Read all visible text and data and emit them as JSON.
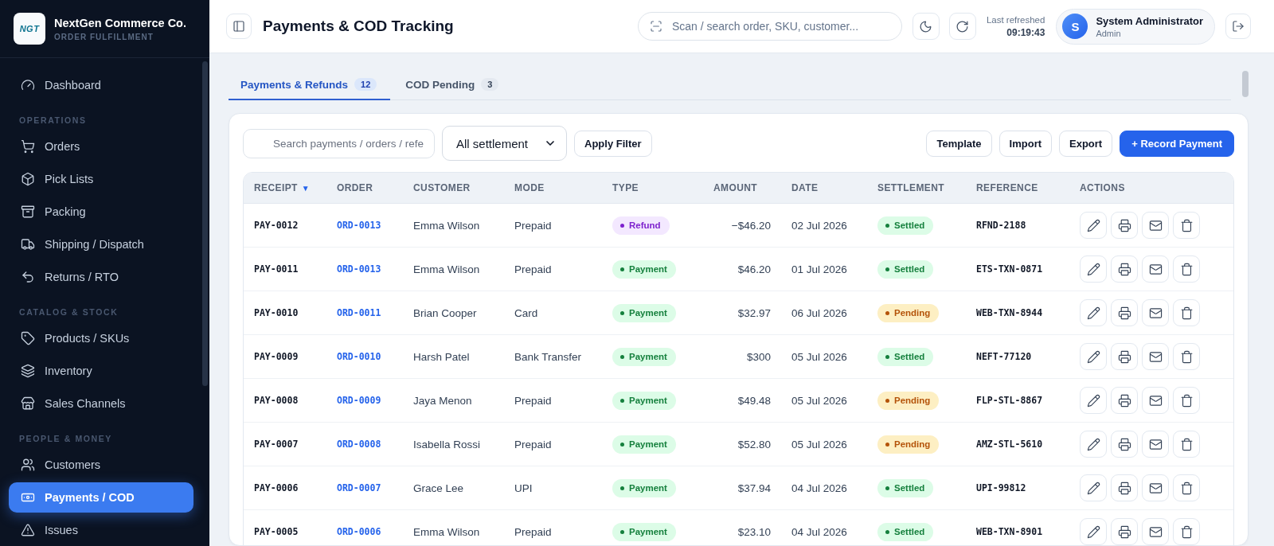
{
  "sidebar": {
    "logo_text": "NGT",
    "brand_name": "NextGen Commerce Co.",
    "brand_subtitle": "ORDER FULFILLMENT",
    "nav": [
      {
        "items": [
          {
            "label": "Dashboard",
            "selected": false
          }
        ]
      },
      {
        "heading": "OPERATIONS",
        "items": [
          {
            "label": "Orders",
            "selected": false
          },
          {
            "label": "Pick Lists",
            "selected": false
          },
          {
            "label": "Packing",
            "selected": false
          },
          {
            "label": "Shipping / Dispatch",
            "selected": false
          },
          {
            "label": "Returns / RTO",
            "selected": false
          }
        ]
      },
      {
        "heading": "CATALOG & STOCK",
        "items": [
          {
            "label": "Products / SKUs",
            "selected": false
          },
          {
            "label": "Inventory",
            "selected": false
          },
          {
            "label": "Sales Channels",
            "selected": false
          }
        ]
      },
      {
        "heading": "PEOPLE & MONEY",
        "items": [
          {
            "label": "Customers",
            "selected": false
          },
          {
            "label": "Payments / COD",
            "selected": true
          },
          {
            "label": "Issues",
            "selected": false
          }
        ]
      }
    ]
  },
  "header": {
    "title": "Payments & COD Tracking",
    "search": {
      "placeholder": "Scan / search order, SKU, customer..."
    },
    "last_refreshed": {
      "label": "Last refreshed",
      "time": "09:19:43"
    },
    "user": {
      "initial": "S",
      "name": "System Administrator",
      "role": "Admin"
    }
  },
  "tabs": [
    {
      "label": "Payments & Refunds",
      "count": "12",
      "selected": true
    },
    {
      "label": "COD Pending",
      "count": "3",
      "selected": false
    }
  ],
  "toolbar": {
    "search": {
      "placeholder": "Search payments / orders / refe"
    },
    "settlement_filter": {
      "value": "All settlement"
    },
    "apply_button": "Apply Filter",
    "buttons": [
      {
        "label": "Template",
        "kind": "secondary"
      },
      {
        "label": "Import",
        "kind": "secondary"
      },
      {
        "label": "Export",
        "kind": "secondary"
      },
      {
        "label": "+ Record Payment",
        "kind": "primary"
      }
    ]
  },
  "table": {
    "columns": [
      {
        "label": "RECEIPT",
        "sort_indicator": "▼"
      },
      {
        "label": "ORDER"
      },
      {
        "label": "CUSTOMER"
      },
      {
        "label": "MODE"
      },
      {
        "label": "TYPE"
      },
      {
        "label": "AMOUNT"
      },
      {
        "label": "DATE"
      },
      {
        "label": "SETTLEMENT"
      },
      {
        "label": "REFERENCE"
      },
      {
        "label": "ACTIONS"
      }
    ],
    "rows": [
      {
        "receipt": "PAY-0012",
        "order": "ORD-0013",
        "customer": "Emma Wilson",
        "mode": "Prepaid",
        "type": {
          "kind": "refund",
          "label": "Refund"
        },
        "amount": "−$46.20",
        "date": "02 Jul 2026",
        "settlement": {
          "kind": "settled",
          "label": "Settled"
        },
        "reference": "RFND-2188"
      },
      {
        "receipt": "PAY-0011",
        "order": "ORD-0013",
        "customer": "Emma Wilson",
        "mode": "Prepaid",
        "type": {
          "kind": "payment",
          "label": "Payment"
        },
        "amount": "$46.20",
        "date": "01 Jul 2026",
        "settlement": {
          "kind": "settled",
          "label": "Settled"
        },
        "reference": "ETS-TXN-0871"
      },
      {
        "receipt": "PAY-0010",
        "order": "ORD-0011",
        "customer": "Brian Cooper",
        "mode": "Card",
        "type": {
          "kind": "payment",
          "label": "Payment"
        },
        "amount": "$32.97",
        "date": "06 Jul 2026",
        "settlement": {
          "kind": "pending",
          "label": "Pending"
        },
        "reference": "WEB-TXN-8944"
      },
      {
        "receipt": "PAY-0009",
        "order": "ORD-0010",
        "customer": "Harsh Patel",
        "mode": "Bank Transfer",
        "type": {
          "kind": "payment",
          "label": "Payment"
        },
        "amount": "$300",
        "date": "05 Jul 2026",
        "settlement": {
          "kind": "settled",
          "label": "Settled"
        },
        "reference": "NEFT-77120"
      },
      {
        "receipt": "PAY-0008",
        "order": "ORD-0009",
        "customer": "Jaya Menon",
        "mode": "Prepaid",
        "type": {
          "kind": "payment",
          "label": "Payment"
        },
        "amount": "$49.48",
        "date": "05 Jul 2026",
        "settlement": {
          "kind": "pending",
          "label": "Pending"
        },
        "reference": "FLP-STL-8867"
      },
      {
        "receipt": "PAY-0007",
        "order": "ORD-0008",
        "customer": "Isabella Rossi",
        "mode": "Prepaid",
        "type": {
          "kind": "payment",
          "label": "Payment"
        },
        "amount": "$52.80",
        "date": "05 Jul 2026",
        "settlement": {
          "kind": "pending",
          "label": "Pending"
        },
        "reference": "AMZ-STL-5610"
      },
      {
        "receipt": "PAY-0006",
        "order": "ORD-0007",
        "customer": "Grace Lee",
        "mode": "UPI",
        "type": {
          "kind": "payment",
          "label": "Payment"
        },
        "amount": "$37.94",
        "date": "04 Jul 2026",
        "settlement": {
          "kind": "settled",
          "label": "Settled"
        },
        "reference": "UPI-99812"
      },
      {
        "receipt": "PAY-0005",
        "order": "ORD-0006",
        "customer": "Emma Wilson",
        "mode": "Prepaid",
        "type": {
          "kind": "payment",
          "label": "Payment"
        },
        "amount": "$23.10",
        "date": "04 Jul 2026",
        "settlement": {
          "kind": "settled",
          "label": "Settled"
        },
        "reference": "WEB-TXN-8901"
      }
    ]
  }
}
